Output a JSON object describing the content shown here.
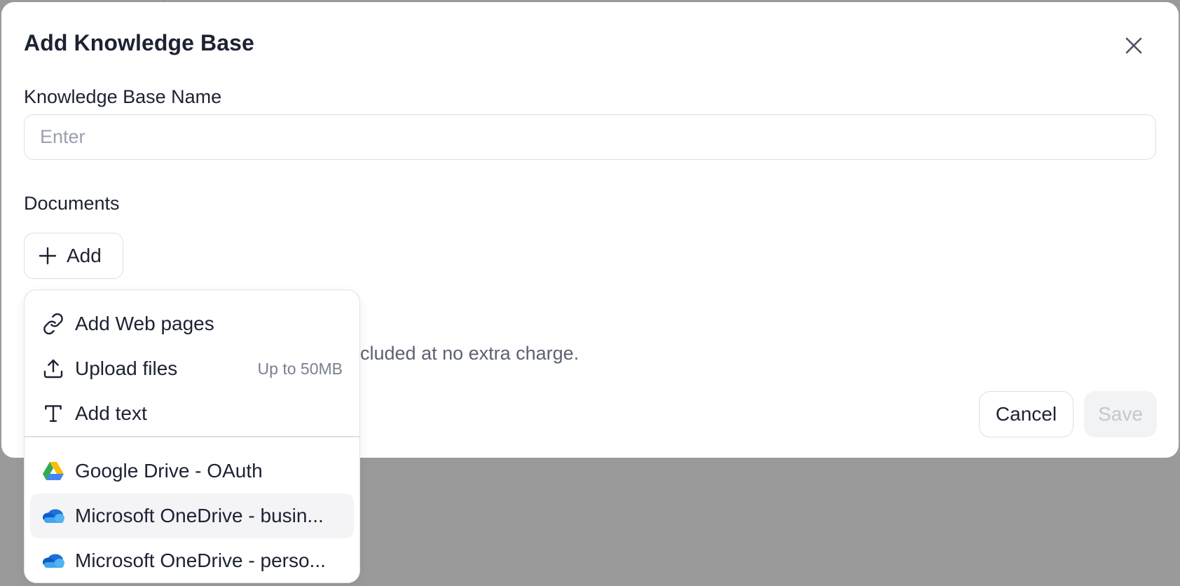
{
  "modal": {
    "title": "Add Knowledge Base",
    "name_label": "Knowledge Base Name",
    "name_placeholder": "Enter",
    "name_value": "",
    "documents_label": "Documents",
    "add_label": "Add",
    "info_text_visible": "cluded at no extra charge.",
    "cancel_label": "Cancel",
    "save_label": "Save"
  },
  "menu": {
    "items": [
      {
        "label": "Add Web pages",
        "icon": "link-icon",
        "hint": ""
      },
      {
        "label": "Upload files",
        "icon": "upload-icon",
        "hint": "Up to 50MB"
      },
      {
        "label": "Add text",
        "icon": "text-icon",
        "hint": ""
      },
      {
        "label": "Google Drive - OAuth",
        "icon": "google-drive-icon",
        "hint": ""
      },
      {
        "label": "Microsoft OneDrive - busin...",
        "icon": "onedrive-icon",
        "hint": ""
      },
      {
        "label": "Microsoft OneDrive - perso...",
        "icon": "onedrive-icon",
        "hint": ""
      }
    ],
    "hovered_index": 4
  },
  "colors": {
    "backdrop": "#9a9a9a",
    "modal_bg": "#ffffff",
    "border": "#dcdfe6",
    "text": "#1d2233",
    "muted_text": "#5c6272",
    "disabled_bg": "#f2f3f5",
    "disabled_text": "#c3c7cf"
  }
}
